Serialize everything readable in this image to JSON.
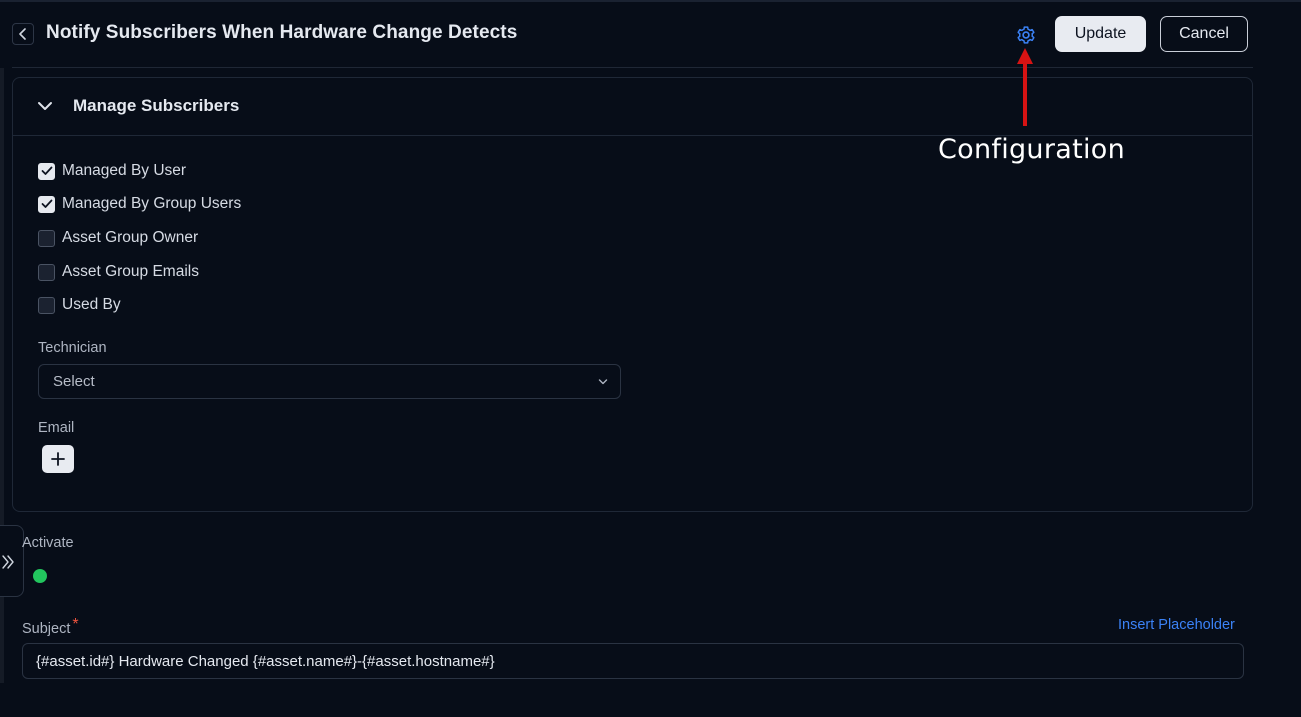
{
  "header": {
    "title": "Notify Subscribers When Hardware Change Detects",
    "update_label": "Update",
    "cancel_label": "Cancel"
  },
  "annotation": {
    "text": "Configuration",
    "arrow_color": "#d71313"
  },
  "manage_subscribers": {
    "title": "Manage Subscribers",
    "checkboxes": [
      {
        "label": "Managed By User",
        "checked": true
      },
      {
        "label": "Managed By Group Users",
        "checked": true
      },
      {
        "label": "Asset Group Owner",
        "checked": false
      },
      {
        "label": "Asset Group Emails",
        "checked": false
      },
      {
        "label": "Used By",
        "checked": false
      }
    ],
    "technician_label": "Technician",
    "technician_value": "Select",
    "email_label": "Email"
  },
  "activate": {
    "label": "Activate",
    "enabled": true
  },
  "subject": {
    "label": "Subject",
    "required_mark": "*",
    "insert_placeholder_label": "Insert Placeholder",
    "value": "{#asset.id#} Hardware Changed {#asset.name#}-{#asset.hostname#}"
  },
  "colors": {
    "accent": "#3b82f6",
    "toggle_on": "#22c55e",
    "background": "#070d18"
  }
}
